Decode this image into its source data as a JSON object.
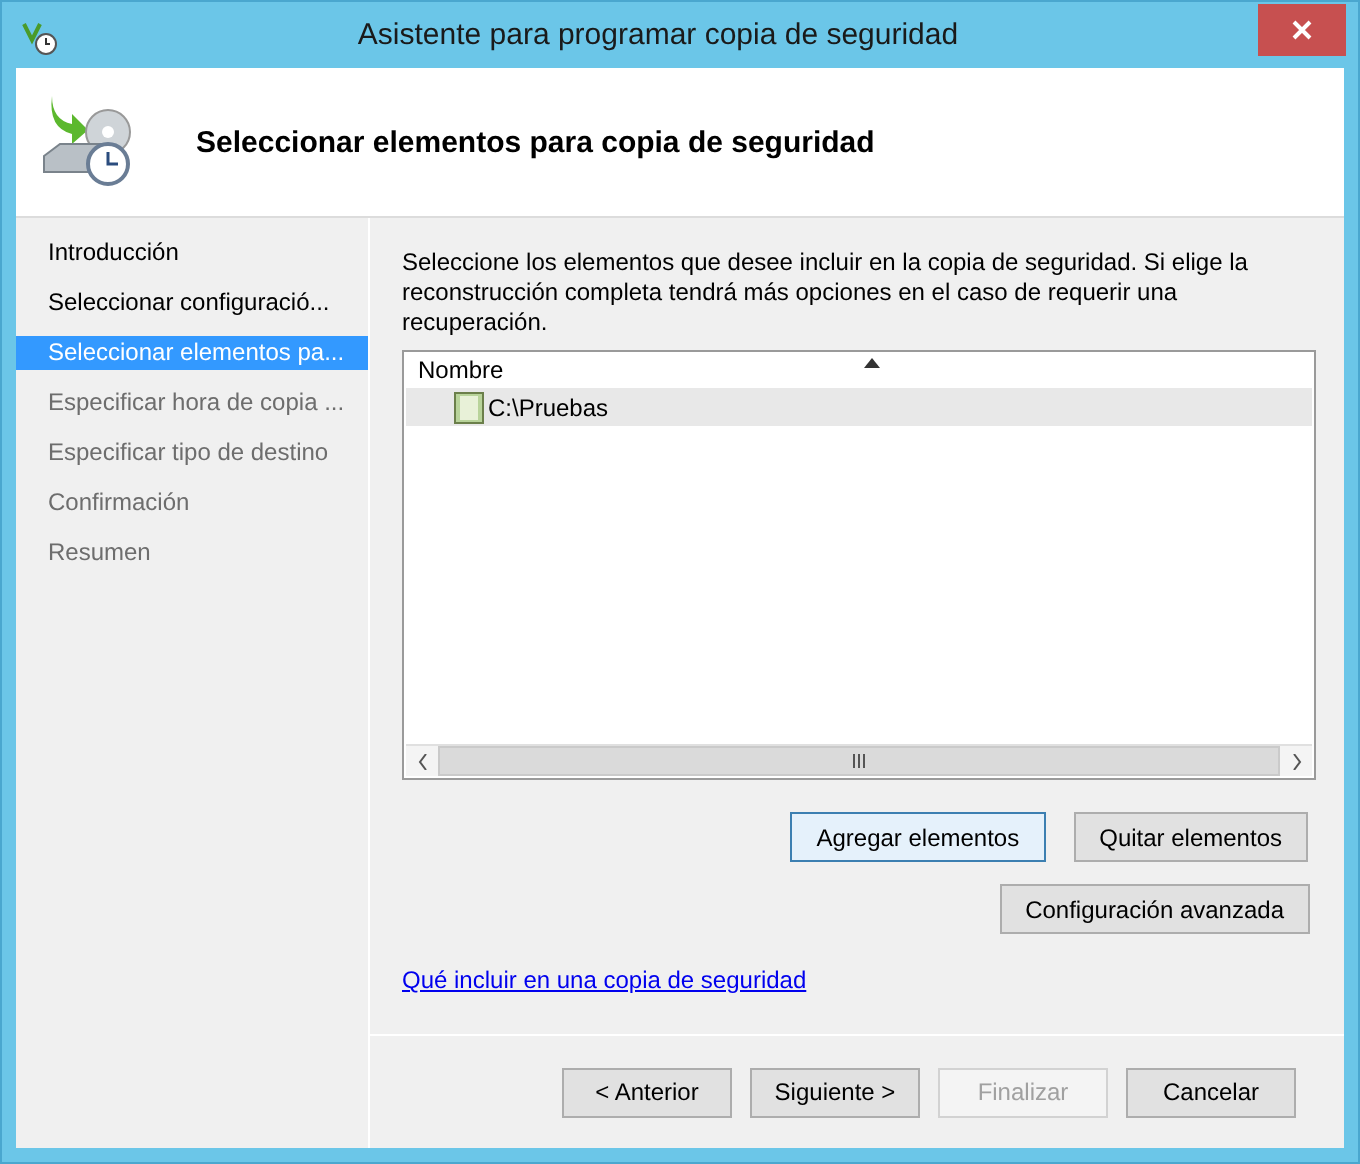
{
  "window": {
    "title": "Asistente para programar copia de seguridad"
  },
  "header": {
    "title": "Seleccionar elementos para copia de seguridad"
  },
  "steps": [
    {
      "label": "Introducción",
      "selected": false,
      "disabled": false
    },
    {
      "label": "Seleccionar configuració...",
      "selected": false,
      "disabled": false
    },
    {
      "label": "Seleccionar elementos pa...",
      "selected": true,
      "disabled": false
    },
    {
      "label": "Especificar hora de copia ...",
      "selected": false,
      "disabled": true
    },
    {
      "label": "Especificar tipo de destino",
      "selected": false,
      "disabled": true
    },
    {
      "label": "Confirmación",
      "selected": false,
      "disabled": true
    },
    {
      "label": "Resumen",
      "selected": false,
      "disabled": true
    }
  ],
  "description": "Seleccione los elementos que desee incluir en la copia de seguridad. Si elige la reconstrucción completa tendrá más opciones en el caso de requerir una recuperación.",
  "list": {
    "columns": [
      "Nombre"
    ],
    "rows": [
      {
        "name": "C:\\Pruebas",
        "selected": true
      }
    ]
  },
  "item_buttons": [
    {
      "label": "Agregar elementos",
      "focused": true
    },
    {
      "label": "Quitar elementos",
      "focused": false
    }
  ],
  "advanced_button": {
    "label": "Configuración avanzada"
  },
  "help_link": "Qué incluir en una copia de seguridad",
  "nav_buttons": [
    {
      "label": "< Anterior",
      "disabled": false
    },
    {
      "label": "Siguiente >",
      "disabled": false
    },
    {
      "label": "Finalizar",
      "disabled": true
    },
    {
      "label": "Cancelar",
      "disabled": false
    }
  ]
}
